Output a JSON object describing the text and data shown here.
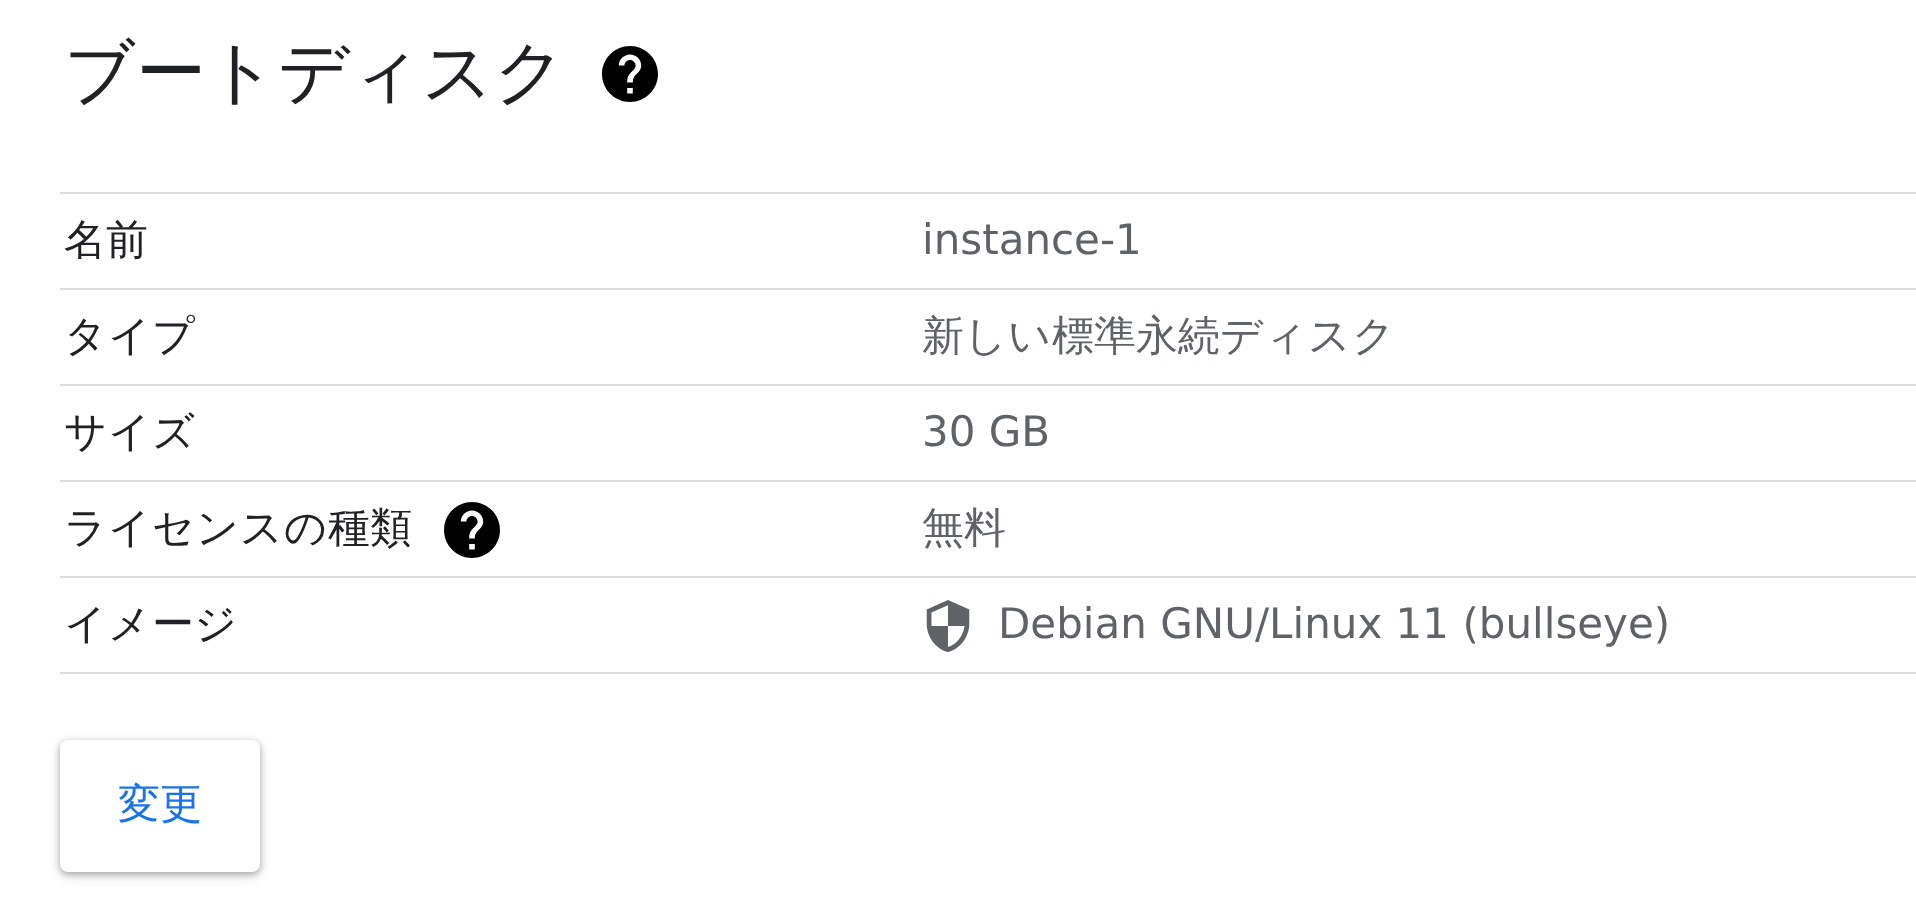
{
  "title": "ブートディスク",
  "title_help": true,
  "rows": [
    {
      "label": "名前",
      "help": false,
      "value": "instance-1",
      "shield": false
    },
    {
      "label": "タイプ",
      "help": false,
      "value": "新しい標準永続ディスク",
      "shield": false
    },
    {
      "label": "サイズ",
      "help": false,
      "value": "30 GB",
      "shield": false
    },
    {
      "label": "ライセンスの種類",
      "help": true,
      "value": "無料",
      "shield": false
    },
    {
      "label": "イメージ",
      "help": false,
      "value": "Debian GNU/Linux 11 (bullseye)",
      "shield": true
    }
  ],
  "button": "変更"
}
